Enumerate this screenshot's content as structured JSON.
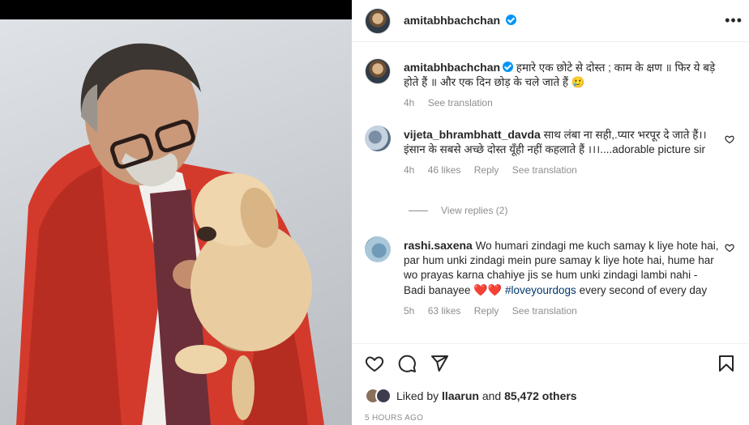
{
  "post": {
    "author": "amitabhbachchan",
    "caption": "हमारे एक छोटे से दोस्त ; काम के क्षण ॥ फिर ये बड़े होते हैं ॥ और एक दिन छोड़ के चले जाते हैं",
    "caption_emoji": "🥲",
    "time_ago": "4h",
    "see_translation": "See translation",
    "more_icon": "•••"
  },
  "comments": [
    {
      "username": "vijeta_bhrambhatt_davda",
      "text": "साथ लंबा ना सही,.प्यार भरपूर दे जाते हैं।। इंसान के सबसे अच्छे दोस्त यूँही नहीं कहलाते हैं ।।।....adorable picture sir",
      "time_ago": "4h",
      "likes": "46 likes",
      "reply": "Reply",
      "see_translation": "See translation",
      "view_replies": "View replies (2)"
    },
    {
      "username": "rashi.saxena",
      "text_before": "Wo humari zindagi me kuch samay k liye hote hai, par hum unki zindagi mein pure samay k liye hote hai, hume har wo prayas karna chahiye jis se hum unki zindagi lambi nahi - Badi banayee",
      "hearts": "❤️❤️",
      "hashtag": "#loveyourdogs",
      "text_after": "every second of every day",
      "time_ago": "5h",
      "likes": "63 likes",
      "reply": "Reply",
      "see_translation": "See translation"
    }
  ],
  "likes_bar": {
    "prefix": "Liked by",
    "user": "llaarun",
    "conjunction": "and",
    "others": "85,472 others",
    "timestamp": "5 HOURS AGO"
  },
  "icons": [
    "heart-icon",
    "comment-icon",
    "share-icon",
    "bookmark-icon",
    "verified-icon",
    "more-icon"
  ],
  "colors": {
    "verified": "#0095f6",
    "link": "#00376b",
    "muted": "#8e8e8e",
    "heart": "#ed4956",
    "jacket": "#d43a2c"
  }
}
